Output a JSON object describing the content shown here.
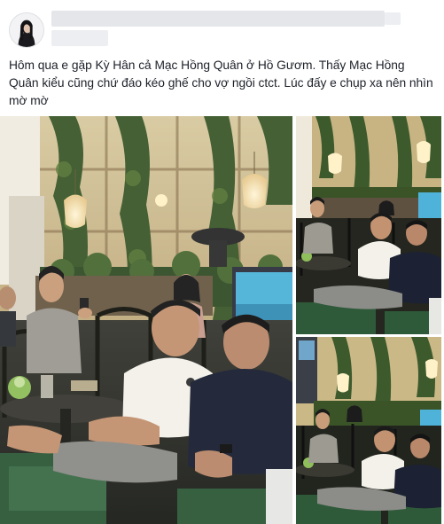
{
  "post": {
    "text": "Hôm qua e gặp Kỳ Hân cả Mạc Hồng Quân ở Hồ Gươm. Thấy Mạc Hồng Quân kiểu cũng chứ đáo kéo ghế cho vợ ngồi ctct. Lúc đấy e chụp xa nên nhìn mờ mờ",
    "photos": [
      "photo-main",
      "photo-top-right",
      "photo-bottom-right"
    ]
  },
  "colors": {
    "text": "#1d2129",
    "blurred_name": "#e4e6ea",
    "foliage": "#3d5a2c",
    "wall": "#c9b78a",
    "aquarium": "#4fb3d9"
  },
  "icons": {
    "avatar": "profile-photo"
  }
}
